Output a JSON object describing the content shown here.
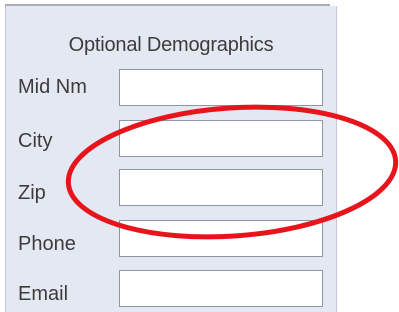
{
  "panel": {
    "title": "Optional Demographics",
    "fields": [
      {
        "label": "Mid Nm",
        "value": "",
        "placeholder": ""
      },
      {
        "label": "City",
        "value": "",
        "placeholder": ""
      },
      {
        "label": "Zip",
        "value": "",
        "placeholder": ""
      },
      {
        "label": "Phone",
        "value": "",
        "placeholder": ""
      },
      {
        "label": "Email",
        "value": "",
        "placeholder": ""
      }
    ]
  },
  "annotation": {
    "shape": "ellipse",
    "color": "#e8141c",
    "highlights": [
      "City",
      "Zip"
    ]
  },
  "colors": {
    "panel_background": "#e4e8f2",
    "text": "#3c3c3c",
    "input_border": "#8f96a3"
  }
}
